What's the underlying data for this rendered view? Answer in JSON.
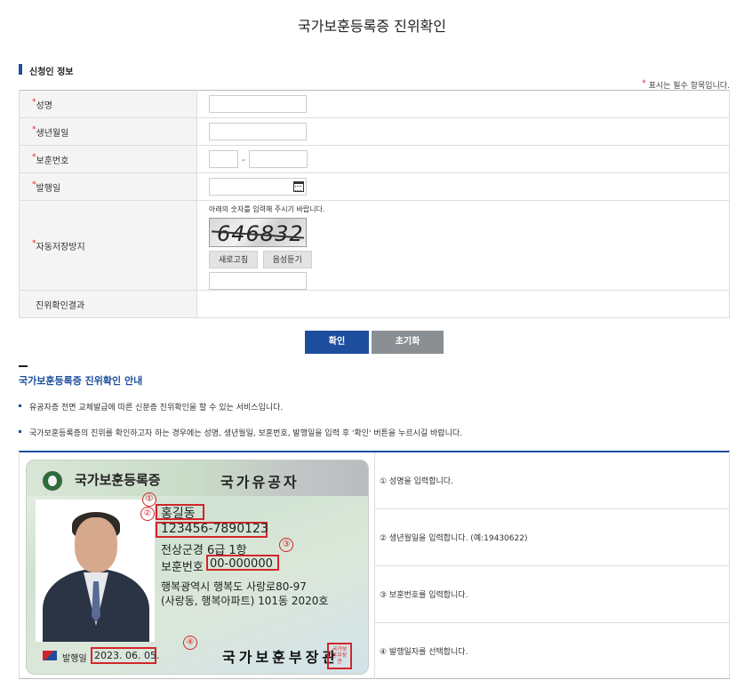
{
  "page_title": "국가보훈등록증 진위확인",
  "applicant_section": {
    "title": "신청인 정보",
    "required_note": "표시는 필수 항목입니다.",
    "required_mark": "*"
  },
  "form": {
    "name_label": "성명",
    "birth_label": "생년월일",
    "veteran_no_label": "보훈번호",
    "veteran_no_separator": "-",
    "issue_date_label": "발행일",
    "captcha_label": "자동저장방지",
    "captcha_hint": "아래의 숫자를 입력해 주시기 바랍니다.",
    "captcha_code": "646832",
    "refresh_label": "새로고침",
    "listen_label": "음성듣기",
    "result_label": "진위확인결과"
  },
  "buttons": {
    "confirm_label": "확인",
    "reset_label": "초기화"
  },
  "guide": {
    "title": "국가보훈등록증 진위확인 안내",
    "bullets": [
      "유공자증 전면 교체발급에 따른 신분증 진위확인을 할 수 있는 서비스입니다.",
      "국가보훈등록증의 진위를 확인하고자 하는 경우에는 성명, 생년월일, 보훈번호, 발행일을 입력 후 '확인' 버튼을 누르시길 바랍니다."
    ],
    "steps": [
      "① 성명을 입력합니다.",
      "② 생년월일을 입력합니다. (예:19430622)",
      "③ 보훈번호를 입력합니다.",
      "④ 발행일자를 선택합니다."
    ]
  },
  "sample_card": {
    "card_title": "국가보훈등록증",
    "card_type": "국가유공자",
    "name": "홍길동",
    "id_number": "123456-7890123",
    "rank": "전상군경 6급 1항",
    "veteran_no_label": "보훈번호",
    "veteran_no": "00-000000",
    "address_line1": "행복광역시 행복도 사랑로80-97",
    "address_line2": "(사랑동, 행복아파트) 101동 2020호",
    "issue_label": "발행일",
    "issue_date": "2023. 06. 05.",
    "issuer": "국가보훈부장관",
    "seal_text": "국가보훈부장관",
    "markers": [
      "①",
      "②",
      "③",
      "④"
    ]
  },
  "colors": {
    "primary": "#1d4e9e",
    "reset_button": "#8a8f93",
    "required": "#e0262f",
    "highlight": "#d3262a"
  }
}
